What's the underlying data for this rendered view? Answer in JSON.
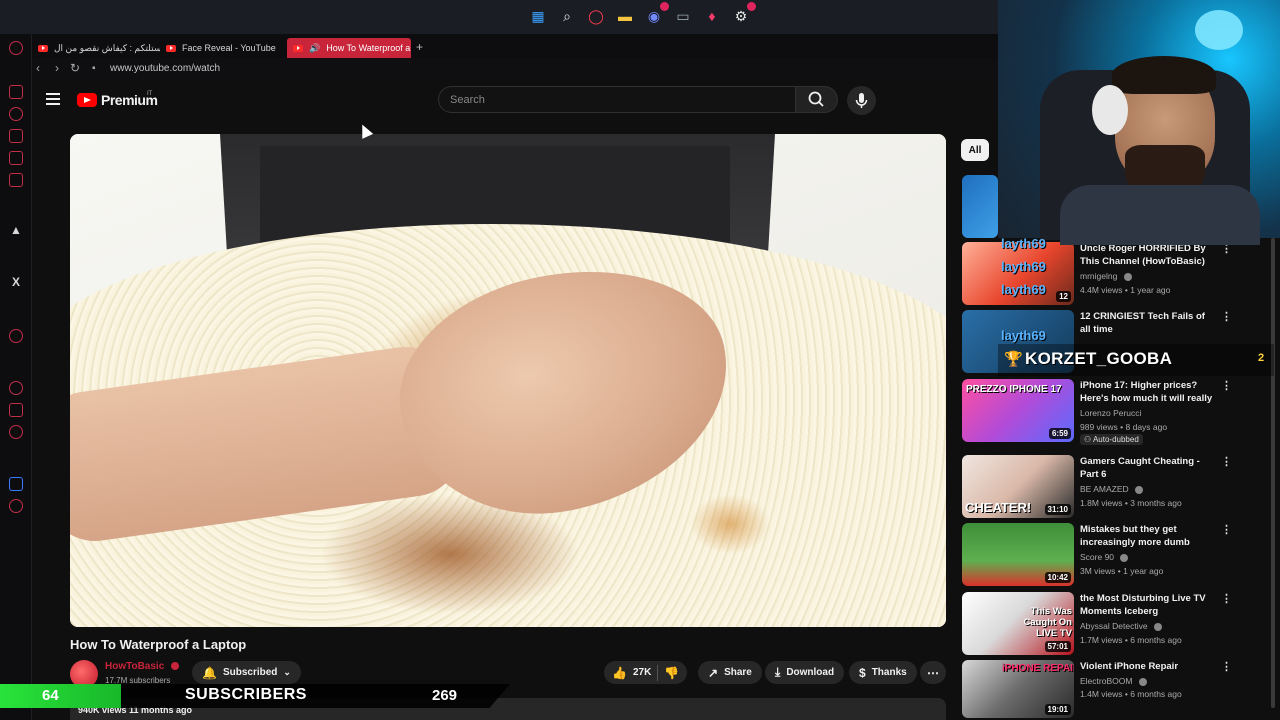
{
  "browser": {
    "tabs": [
      {
        "label": "أستلتكم : كيفاش نقصو من ال"
      },
      {
        "label": "Face Reveal - YouTube"
      },
      {
        "label": "How To Waterproof a"
      }
    ],
    "url": "www.youtube.com/watch"
  },
  "youtube": {
    "logo_text": "Premium",
    "region": "IT",
    "search_placeholder": "Search"
  },
  "video": {
    "title": "How To Waterproof a Laptop",
    "channel": "HowToBasic",
    "subscribers": "17.7M subscribers",
    "subscribed_label": "Subscribed",
    "likes": "27K",
    "share_label": "Share",
    "download_label": "Download",
    "thanks_label": "Thanks",
    "views_meta": "940K views  11 months ago"
  },
  "chips": {
    "all": "All"
  },
  "recommendations": [
    {
      "title": "Uncle Roger HORRIFIED By This Channel (HowToBasic)",
      "channel": "mrnigelng",
      "meta": "4.4M views • 1 year ago",
      "duration": "12"
    },
    {
      "title": "12 CRINGIEST Tech Fails of all time",
      "channel": "",
      "meta": "",
      "duration": ""
    },
    {
      "title": "iPhone 17: Higher prices? Here's how much it will really ...",
      "channel": "Lorenzo Perucci",
      "meta": "989 views • 8 days ago",
      "duration": "6:59",
      "badge": "Auto-dubbed",
      "thumb_text": "PREZZO IPHONE 17"
    },
    {
      "title": "Gamers Caught Cheating - Part 6",
      "channel": "BE AMAZED",
      "meta": "1.8M views • 3 months ago",
      "duration": "31:10",
      "thumb_text": "CHEATER!"
    },
    {
      "title": "Mistakes but they get increasingly more dumb",
      "channel": "Score 90",
      "meta": "3M views • 1 year ago",
      "duration": "10:42"
    },
    {
      "title": "the Most Disturbing Live TV Moments Iceberg",
      "channel": "Abyssal Detective",
      "meta": "1.7M views • 6 months ago",
      "duration": "57:01",
      "thumb_text": "This Was Caught On LIVE TV"
    },
    {
      "title": "Violent iPhone Repair",
      "channel": "ElectroBOOM",
      "meta": "1.4M views • 6 months ago",
      "duration": "19:01",
      "thumb_text": "iPHONE REPAIR"
    }
  ],
  "stream_overlay": {
    "chat_names": [
      "layth69",
      "layth69",
      "layth69",
      "layth69"
    ],
    "alert_name": "KORZET_GOOBA",
    "alert_count": "2",
    "goal_current": "64",
    "goal_label": "SUBSCRIBERS",
    "goal_target": "269"
  },
  "colors": {
    "accent_red": "#ff0000",
    "opera_red": "#c8243a",
    "goal_green": "#29e33a",
    "chat_blue": "#5bb4ff"
  }
}
